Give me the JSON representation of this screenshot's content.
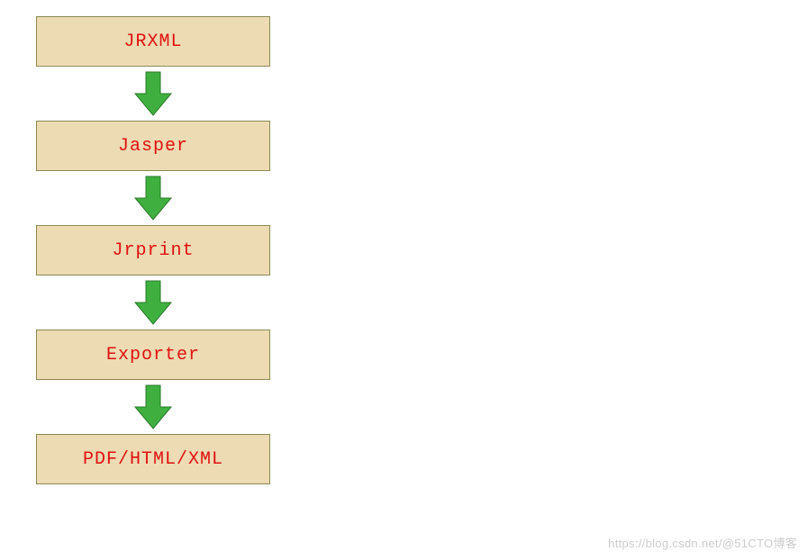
{
  "diagram": {
    "boxes": [
      {
        "label": "JRXML"
      },
      {
        "label": "Jasper"
      },
      {
        "label": "Jrprint"
      },
      {
        "label": "Exporter"
      },
      {
        "label": "PDF/HTML/XML"
      }
    ]
  },
  "watermark": "https://blog.csdn.net/@51CTO博客",
  "colors": {
    "boxFill": "#ecdbb3",
    "boxBorder": "#8a8a55",
    "boxText": "#e11010",
    "arrowFill": "#3fb03f",
    "arrowStroke": "#2a7a2a"
  }
}
